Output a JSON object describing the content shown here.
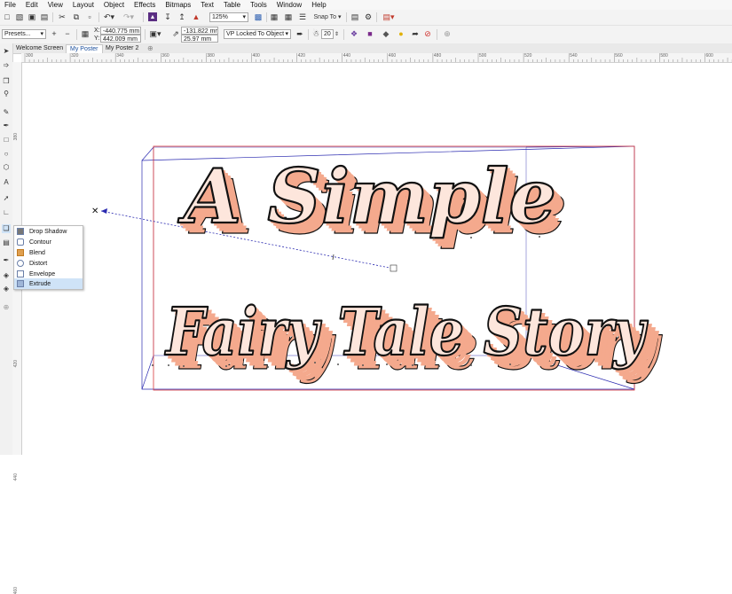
{
  "menu": [
    "File",
    "Edit",
    "View",
    "Layout",
    "Object",
    "Effects",
    "Bitmaps",
    "Text",
    "Table",
    "Tools",
    "Window",
    "Help"
  ],
  "standard_toolbar": {
    "zoom": "125%",
    "snap_to": "Snap To"
  },
  "property_bar": {
    "presets": "Presets...",
    "x_label": "X:",
    "x_value": "-440.775 mm",
    "y_label": "Y:",
    "y_value": "442.009 mm",
    "vp_x": "-131.822 mm",
    "vp_y": "25.97 mm",
    "vp_mode": "VP Locked To Object",
    "depth": "20"
  },
  "tabs": [
    {
      "label": "Welcome Screen",
      "active": false
    },
    {
      "label": "My Poster",
      "active": true
    },
    {
      "label": "My Poster 2",
      "active": false
    }
  ],
  "ruler": {
    "h_ticks": [
      "300",
      "320",
      "340",
      "360",
      "380",
      "400",
      "420",
      "440",
      "460",
      "480",
      "500",
      "520",
      "540",
      "560",
      "580",
      "600"
    ],
    "v_ticks": [
      "380",
      "400",
      "420",
      "440",
      "460"
    ]
  },
  "flyout": {
    "items": [
      {
        "label": "Drop Shadow",
        "icon": "drop-shadow-icon",
        "selected": false
      },
      {
        "label": "Contour",
        "icon": "contour-icon",
        "selected": false
      },
      {
        "label": "Blend",
        "icon": "blend-icon",
        "selected": false
      },
      {
        "label": "Distort",
        "icon": "distort-icon",
        "selected": false
      },
      {
        "label": "Envelope",
        "icon": "envelope-icon",
        "selected": false
      },
      {
        "label": "Extrude",
        "icon": "extrude-icon",
        "selected": true
      }
    ]
  },
  "artwork": {
    "line1": "A Simple",
    "line2": "Fairy Tale Story",
    "face_color": "#fde6dc",
    "extrude_color": "#f4a98d",
    "outline_color": "#111111",
    "bbox_color": "#d8383a",
    "vp_line_color": "#2a2ab0"
  }
}
